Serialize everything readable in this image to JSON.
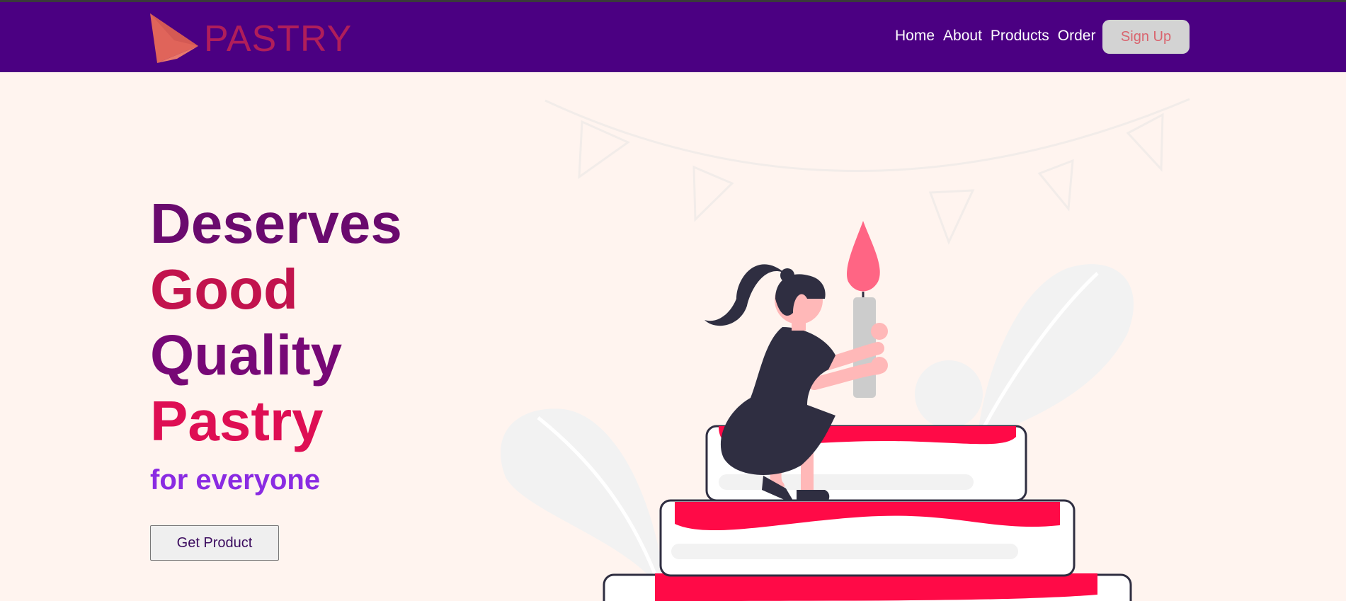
{
  "navbar": {
    "brand": "PASTRY",
    "links": [
      "Home",
      "About",
      "Products",
      "Order"
    ],
    "signup_label": "Sign Up"
  },
  "hero": {
    "lines": [
      "Deserves",
      "Good",
      "Quality",
      "Pastry"
    ],
    "subtitle": "for everyone",
    "cta_label": "Get Product"
  },
  "colors": {
    "navbar_bg": "#4b0082",
    "page_bg": "#fff4ef",
    "accent_red": "#ff0a47",
    "accent_purple": "#8a2be2"
  },
  "icons": {
    "logo": "triangle-logo-icon",
    "illustration": "birthday-cake-girl-candle-illustration"
  }
}
